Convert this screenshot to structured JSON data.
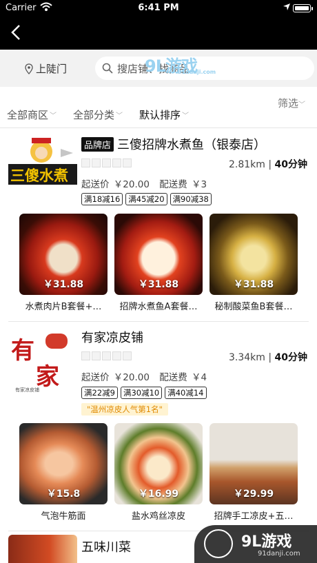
{
  "status": {
    "carrier": "Carrier",
    "time": "6:41 PM"
  },
  "search": {
    "location": "上陡门",
    "placeholder": "搜店铺、找商品"
  },
  "watermark_top": {
    "logo": "9L游戏",
    "url": "91danji.com"
  },
  "filters": {
    "area": "全部商区",
    "category": "全部分类",
    "sort": "默认排序",
    "screen": "筛选"
  },
  "stores": [
    {
      "badge": "品牌店",
      "name": "三傻招牌水煮鱼（银泰店）",
      "distance": "2.81km",
      "time": "40分钟",
      "min_label": "起送价",
      "min_price": "￥20.00",
      "fee_label": "配送费",
      "fee": "￥3",
      "tags": [
        "满18减16",
        "满45减20",
        "满90减38"
      ],
      "dishes": [
        {
          "price": "￥31.88",
          "name": "水煮肉片B套餐+…"
        },
        {
          "price": "￥31.88",
          "name": "招牌水煮鱼A套餐…"
        },
        {
          "price": "￥31.88",
          "name": "秘制酸菜鱼B套餐…"
        }
      ]
    },
    {
      "name": "有家凉皮铺",
      "distance": "3.34km",
      "time": "40分钟",
      "min_label": "起送价",
      "min_price": "￥20.00",
      "fee_label": "配送费",
      "fee": "￥4",
      "tags": [
        "满22减9",
        "满30减10",
        "满40减14"
      ],
      "promo": "\"温州凉皮人气第1名\"",
      "dishes": [
        {
          "price": "￥15.8",
          "name": "气泡牛筋面"
        },
        {
          "price": "￥16.99",
          "name": "盐水鸡丝凉皮"
        },
        {
          "price": "￥29.99",
          "name": "招牌手工凉皮+五…"
        }
      ]
    },
    {
      "name": "五味川菜"
    }
  ],
  "watermark_bottom": {
    "logo": "9L游戏",
    "url": "91danji.com"
  }
}
